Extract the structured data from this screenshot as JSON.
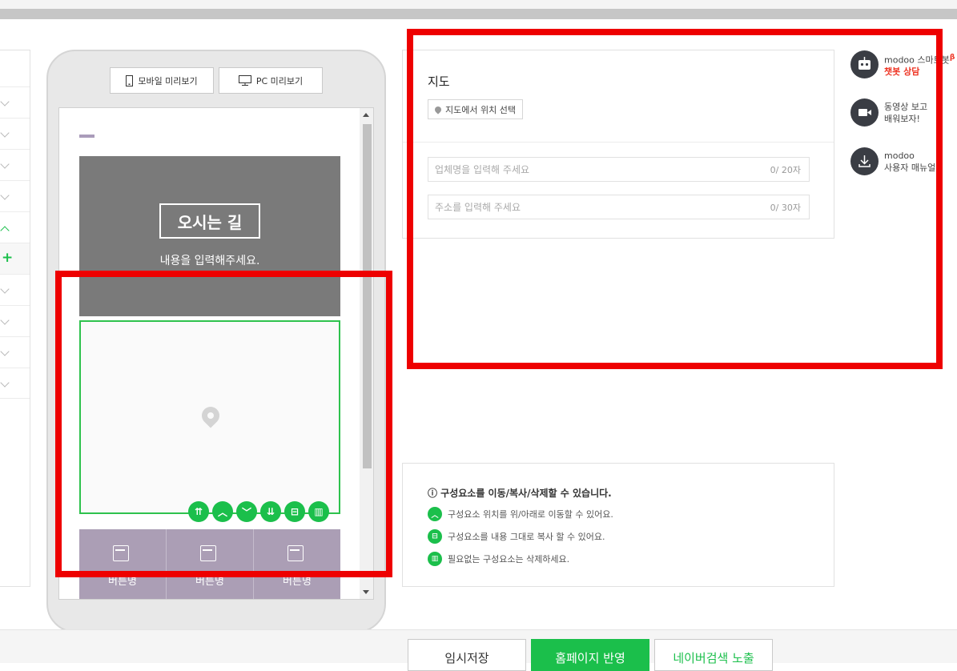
{
  "preview": {
    "mobile_label": "모바일 미리보기",
    "pc_label": "PC 미리보기"
  },
  "phone_screen": {
    "banner_title": "오시는 길",
    "banner_subtitle": "내용을 입력해주세요.",
    "button_labels": [
      "버튼명",
      "버튼명",
      "버튼명"
    ]
  },
  "map_panel": {
    "title": "지도",
    "locate_button": "지도에서 위치 선택",
    "business_placeholder": "업체명을 입력해 주세요",
    "business_counter": "0/ 20자",
    "address_placeholder": "주소를 입력해 주세요",
    "address_counter": "0/ 30자"
  },
  "help": {
    "heading": "ⓘ 구성요소를 이동/복사/삭제할 수 있습니다.",
    "move_text": "구성요소 위치를 위/아래로 이동할 수 있어요.",
    "copy_text": "구성요소를 내용 그대로 복사 할 수 있어요.",
    "delete_text": "필요없는 구성요소는 삭제하세요."
  },
  "side_helpers": {
    "chatbot_line1": "modoo 스마트봇",
    "chatbot_beta": "β",
    "chatbot_line2": "챗봇 상담",
    "video_line1": "동영상 보고",
    "video_line2": "배워보자!",
    "manual_line1": "modoo",
    "manual_line2": "사용자 매뉴얼"
  },
  "bottom_bar": {
    "save_label": "임시저장",
    "publish_label": "홈페이지 반영",
    "naver_label": "네이버검색 노출"
  },
  "colors": {
    "accent_green": "#1bbf4b",
    "highlight_red": "#ee0000",
    "button_purple": "#ab9eb5"
  }
}
